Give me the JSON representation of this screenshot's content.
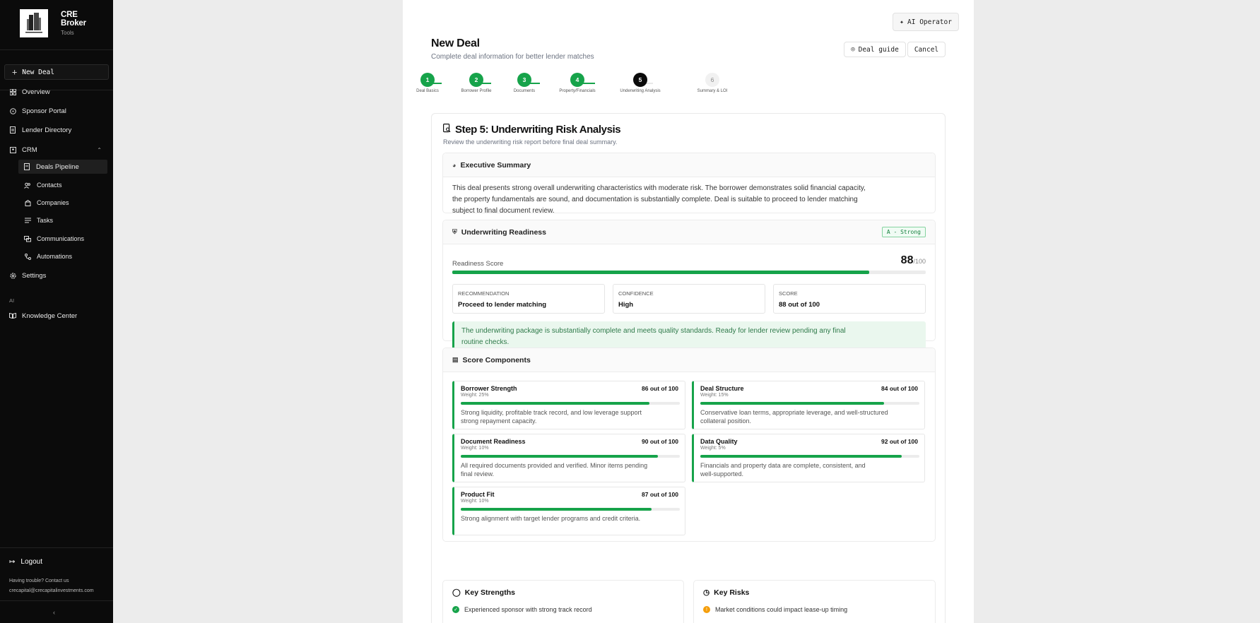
{
  "sidebar": {
    "brand_name": "CRE Broker",
    "brand_sub": "Tools",
    "new_deal": "New Deal",
    "nav": [
      {
        "label": "Overview",
        "icon": "grid-icon"
      },
      {
        "label": "Sponsor Portal",
        "icon": "compass-icon"
      },
      {
        "label": "Lender Directory",
        "icon": "document-icon"
      },
      {
        "label": "CRM",
        "icon": "contacts-icon"
      }
    ],
    "crm_items": [
      {
        "label": "Deals Pipeline",
        "icon": "file-icon",
        "active": true
      },
      {
        "label": "Contacts",
        "icon": "users-icon"
      },
      {
        "label": "Companies",
        "icon": "building-icon"
      },
      {
        "label": "Tasks",
        "icon": "list-icon"
      },
      {
        "label": "Communications",
        "icon": "chat-icon"
      },
      {
        "label": "Automations",
        "icon": "workflow-icon"
      }
    ],
    "settings": "Settings",
    "ai_section": "AI",
    "knowledge_center": "Knowledge Center",
    "logout": "Logout",
    "help_line1": "Having trouble? Contact us",
    "help_line2": "crecapital@crecapitalinvestments.com"
  },
  "header": {
    "ai_operator": "AI Operator",
    "title": "New Deal",
    "subtitle": "Complete deal information for better lender matches",
    "deal_guide": "Deal guide",
    "cancel": "Cancel"
  },
  "stepper": [
    {
      "num": "1",
      "label": "Deal Basics",
      "state": "done"
    },
    {
      "num": "2",
      "label": "Borrower Profile",
      "state": "done"
    },
    {
      "num": "3",
      "label": "Documents",
      "state": "done"
    },
    {
      "num": "4",
      "label": "Property/Financials",
      "state": "done"
    },
    {
      "num": "5",
      "label": "Underwriting Analysis",
      "state": "current"
    },
    {
      "num": "6",
      "label": "Summary & LOI",
      "state": "todo"
    }
  ],
  "step": {
    "title": "Step 5: Underwriting Risk Analysis",
    "description": "Review the underwriting risk report before final deal summary."
  },
  "executive_summary": {
    "heading": "Executive Summary",
    "lines": [
      "This deal presents strong overall underwriting characteristics with moderate risk. The borrower demonstrates solid financial capacity,",
      "the property fundamentals are sound, and documentation is substantially complete. Deal is suitable to proceed to lender matching",
      "subject to final document review."
    ]
  },
  "readiness": {
    "heading": "Underwriting Readiness",
    "badge": "A - Strong",
    "score_label": "Readiness Score",
    "score": "88",
    "score_max": "/100",
    "score_fraction": 0.88,
    "metrics": [
      {
        "key": "Recommendation",
        "value": "Proceed to lender matching"
      },
      {
        "key": "Confidence",
        "value": "High"
      },
      {
        "key": "Score",
        "value": "88 out of 100"
      }
    ],
    "callout_lines": [
      "The underwriting package is substantially complete and meets quality standards. Ready for lender review pending any final",
      "routine checks."
    ]
  },
  "score_components": {
    "heading": "Score Components",
    "items": [
      {
        "name": "Borrower Strength",
        "score": "86 out of 100",
        "value": 86,
        "weight": "Weight: 25%",
        "desc": [
          "Strong liquidity, profitable track record, and low leverage support",
          "strong repayment capacity."
        ]
      },
      {
        "name": "Deal Structure",
        "score": "84 out of 100",
        "value": 84,
        "weight": "Weight: 15%",
        "desc": [
          "Conservative loan terms, appropriate leverage, and well-structured",
          "collateral position."
        ]
      },
      {
        "name": "Document Readiness",
        "score": "90 out of 100",
        "value": 90,
        "weight": "Weight: 10%",
        "desc": [
          "All required documents provided and verified. Minor items pending",
          "final review."
        ]
      },
      {
        "name": "Data Quality",
        "score": "92 out of 100",
        "value": 92,
        "weight": "Weight: 5%",
        "desc": [
          "Financials and property data are complete, consistent, and",
          "well-supported."
        ]
      },
      {
        "name": "Product Fit",
        "score": "87 out of 100",
        "value": 87,
        "weight": "Weight: 10%",
        "desc": [
          "Strong alignment with target lender programs and credit criteria.",
          ""
        ]
      }
    ]
  },
  "key_strengths": {
    "heading": "Key Strengths",
    "first_item": "Experienced sponsor with strong track record"
  },
  "key_risks": {
    "heading": "Key Risks",
    "first_item": "Market conditions could impact lease-up timing"
  },
  "colors": {
    "accent": "#16a34a",
    "warning": "#f59e0b",
    "sidebar_bg": "#0b0b0b"
  }
}
